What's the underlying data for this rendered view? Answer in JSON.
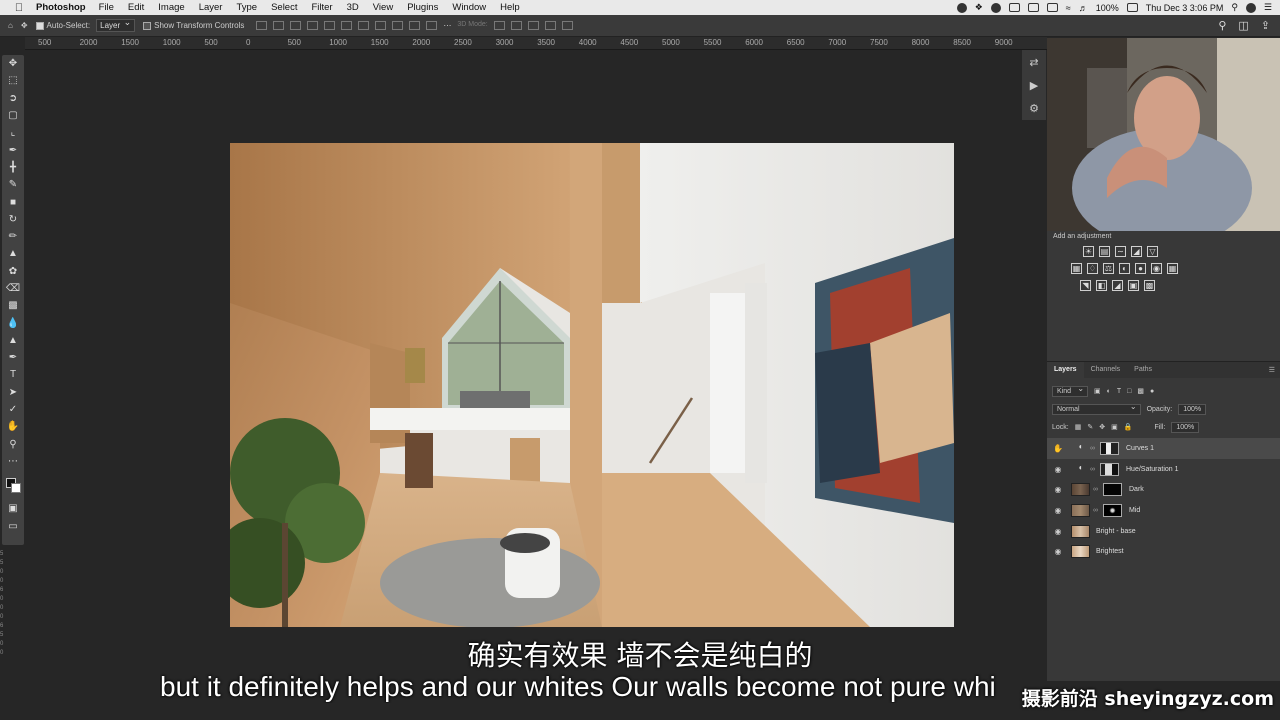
{
  "menubar": {
    "app_name": "Photoshop",
    "menus": [
      "File",
      "Edit",
      "Image",
      "Layer",
      "Type",
      "Select",
      "Filter",
      "3D",
      "View",
      "Plugins",
      "Window",
      "Help"
    ],
    "battery": "100%",
    "datetime": "Thu Dec 3  3:06 PM"
  },
  "options": {
    "auto_select_label": "Auto-Select:",
    "auto_select_value": "Layer",
    "transform_label": "Show Transform Controls",
    "mode_label": "3D Mode:"
  },
  "ruler": {
    "ticks": [
      "500",
      "2000",
      "1500",
      "1000",
      "500",
      "0",
      "500",
      "1000",
      "1500",
      "2000",
      "2500",
      "3000",
      "3500",
      "4000",
      "4500",
      "5000",
      "5500",
      "6000",
      "6500",
      "7000",
      "7500",
      "8000",
      "8500",
      "9000"
    ],
    "vertical": [
      "5",
      "5",
      "0",
      "0",
      "6",
      "0",
      "0",
      "0",
      "6",
      "5",
      "0",
      "0"
    ]
  },
  "adjustments": {
    "title": "Add an adjustment"
  },
  "layers_panel": {
    "tabs": [
      "Layers",
      "Channels",
      "Paths"
    ],
    "filter_kind": "Kind",
    "blend_mode": "Normal",
    "opacity_label": "Opacity:",
    "opacity_value": "100%",
    "lock_label": "Lock:",
    "fill_label": "Fill:",
    "fill_value": "100%",
    "layers": [
      {
        "name": "Curves 1",
        "type": "adjustment",
        "selected": true
      },
      {
        "name": "Hue/Saturation 1",
        "type": "adjustment",
        "selected": false
      },
      {
        "name": "Dark",
        "type": "pixel",
        "selected": false
      },
      {
        "name": "Mid",
        "type": "pixel",
        "selected": false
      },
      {
        "name": "Bright - base",
        "type": "pixel",
        "selected": false
      },
      {
        "name": "Brightest",
        "type": "pixel",
        "selected": false
      }
    ]
  },
  "subtitles": {
    "chinese": "确实有效果 墙不会是纯白的",
    "english": "but it definitely helps and our whites Our walls become not pure whi"
  },
  "watermark": "摄影前沿 sheyingzyz.com"
}
